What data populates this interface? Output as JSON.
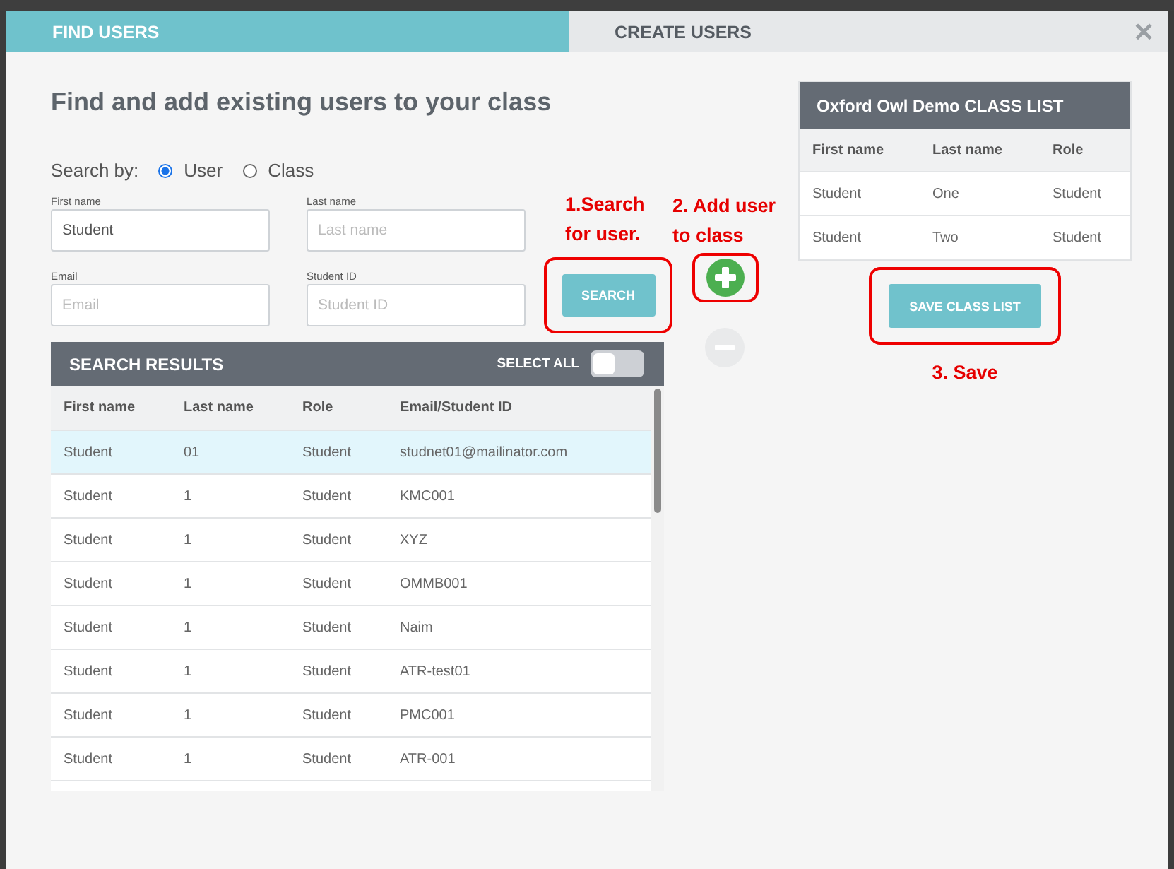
{
  "tabs": [
    {
      "label": "FIND USERS",
      "selected": true
    },
    {
      "label": "CREATE USERS",
      "selected": false
    }
  ],
  "close": "✕",
  "title": "Find and add existing users to your class",
  "search_by": {
    "label": "Search by:",
    "options": [
      {
        "label": "User",
        "selected": true
      },
      {
        "label": "Class",
        "selected": false
      }
    ]
  },
  "fields": [
    {
      "label": "First name",
      "value": "Student"
    },
    {
      "label": "Last name",
      "placeholder": "Last name"
    },
    {
      "label": "Email",
      "placeholder": "Email"
    },
    {
      "label": "Student ID",
      "placeholder": "Student ID"
    }
  ],
  "search_button": "SEARCH",
  "annotations": {
    "search": [
      "1.Search",
      "for user."
    ],
    "add": [
      "2. Add user",
      "to class"
    ],
    "save": "3. Save"
  },
  "results": {
    "title": "SEARCH RESULTS",
    "select_all": {
      "label": "SELECT ALL",
      "on": false
    },
    "columns": [
      "First name",
      "Last name",
      "Role",
      "Email/Student ID"
    ],
    "rows": [
      {
        "cells": [
          "Student",
          "01",
          "Student",
          "studnet01@mailinator.com"
        ],
        "selected": true
      },
      {
        "cells": [
          "Student",
          "1",
          "Student",
          "KMC001"
        ],
        "selected": false
      },
      {
        "cells": [
          "Student",
          "1",
          "Student",
          "XYZ"
        ],
        "selected": false
      },
      {
        "cells": [
          "Student",
          "1",
          "Student",
          "OMMB001"
        ],
        "selected": false
      },
      {
        "cells": [
          "Student",
          "1",
          "Student",
          "Naim"
        ],
        "selected": false
      },
      {
        "cells": [
          "Student",
          "1",
          "Student",
          "ATR-test01"
        ],
        "selected": false
      },
      {
        "cells": [
          "Student",
          "1",
          "Student",
          "PMC001"
        ],
        "selected": false
      },
      {
        "cells": [
          "Student",
          "1",
          "Student",
          "ATR-001"
        ],
        "selected": false
      }
    ]
  },
  "class_list": {
    "title": "Oxford Owl Demo CLASS LIST",
    "columns": [
      "First name",
      "Last name",
      "Role"
    ],
    "rows": [
      [
        "Student",
        "One",
        "Student"
      ],
      [
        "Student",
        "Two",
        "Student"
      ]
    ]
  },
  "save_button": "SAVE CLASS LIST"
}
